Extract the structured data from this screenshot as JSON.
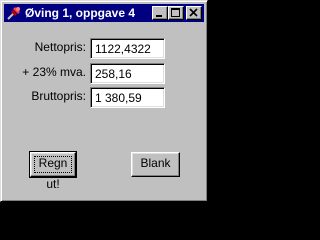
{
  "window": {
    "title": "Øving 1, oppgave 4",
    "icon": "pin-icon",
    "controls": [
      "minimize-icon",
      "maximize-icon",
      "close-icon"
    ]
  },
  "form": {
    "nettopris_label": "Nettopris:",
    "nettopris_value": "1122,4322",
    "mva_label": "+ 23% mva.",
    "mva_value": "258,16",
    "bruttopris_label": "Bruttopris:",
    "bruttopris_value": "1 380,59"
  },
  "buttons": {
    "calculate_label": "Regn ut!",
    "clear_label": "Blank"
  },
  "colors": {
    "titlebar": "#000080",
    "window": "#c0c0c0"
  }
}
